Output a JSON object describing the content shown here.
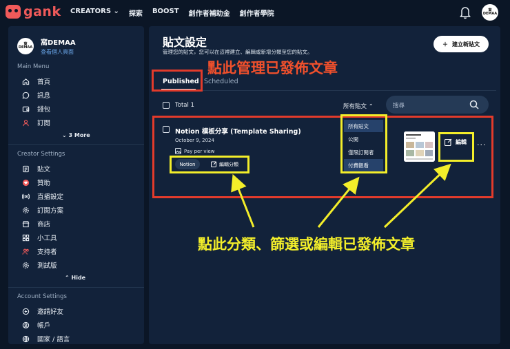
{
  "nav": {
    "brand": "gank",
    "items": [
      "CREATORS",
      "探索",
      "BOOST",
      "創作者補助金",
      "創作者學院"
    ]
  },
  "user": {
    "avatar_text_1": "窩",
    "avatar_text_2": "DEMAA",
    "name": "窩DEMAA",
    "view_profile": "查看個人頁面"
  },
  "sidebar": {
    "main_menu_title": "Main Menu",
    "main_items": [
      "首頁",
      "訊息",
      "錢包",
      "訂閱"
    ],
    "more": "3 More",
    "creator_title": "Creator Settings",
    "creator_items": [
      "貼文",
      "贊助",
      "直播設定",
      "訂閱方案",
      "商店",
      "小工具",
      "支持者",
      "測試版"
    ],
    "hide": "Hide",
    "account_title": "Account Settings",
    "account_items": [
      "邀請好友",
      "帳戶",
      "國家 / 語言"
    ]
  },
  "page": {
    "title": "貼文設定",
    "subtitle": "管理您的貼文，您可以在這裡建立、編輯或新增分類至您的貼文。",
    "new_post": "建立新貼文",
    "tabs": {
      "published": "Published",
      "scheduled": "Scheduled"
    },
    "total": "Total 1",
    "filter": "所有貼文",
    "search_placeholder": "搜尋"
  },
  "post": {
    "title": "Notion 模板分享 (Template Sharing)",
    "date": "October 9, 2024",
    "access": "Pay per view",
    "tag": "Notion",
    "edit_category": "編輯分類",
    "edit": "編輯",
    "more": "···"
  },
  "filter_menu": {
    "options": [
      "所有貼文",
      "公開",
      "僅限訂閱者",
      "付費觀看"
    ],
    "selected": [
      "所有貼文",
      "付費觀看"
    ]
  },
  "annotations": {
    "top": "點此管理已發佈文章",
    "bottom": "點此分類、篩選或編輯已發佈文章",
    "red": "#e33b2b",
    "yellow": "#f3ee2a"
  }
}
